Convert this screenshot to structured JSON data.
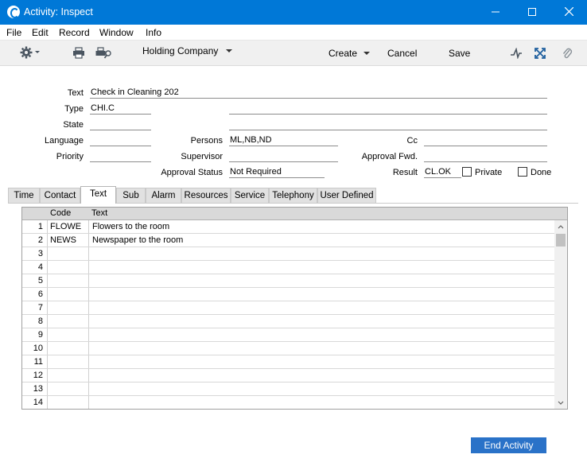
{
  "window": {
    "title": "Activity: Inspect",
    "minimize": "—",
    "maximize": "☐",
    "close": "✕"
  },
  "menu": [
    "File",
    "Edit",
    "Record",
    "Window",
    "Info"
  ],
  "toolbar": {
    "company": "Holding Company",
    "create": "Create",
    "cancel": "Cancel",
    "save": "Save"
  },
  "form": {
    "text_label": "Text",
    "text_value": "Check in Cleaning 202",
    "type_label": "Type",
    "type_value": "CHI.C",
    "state_label": "State",
    "state_value": "",
    "language_label": "Language",
    "language_value": "",
    "priority_label": "Priority",
    "priority_value": "",
    "persons_label": "Persons",
    "persons_value": "ML,NB,ND",
    "supervisor_label": "Supervisor",
    "supervisor_value": "",
    "approval_status_label": "Approval Status",
    "approval_status_value": "Not Required",
    "cc_label": "Cc",
    "cc_value": "",
    "approval_fwd_label": "Approval Fwd.",
    "approval_fwd_value": "",
    "result_label": "Result",
    "result_value": "CL.OK",
    "private_label": "Private",
    "private_checked": false,
    "done_label": "Done",
    "done_checked": false
  },
  "tabs": [
    "Time",
    "Contact",
    "Text",
    "Sub",
    "Alarm",
    "Resources",
    "Service",
    "Telephony",
    "User Defined"
  ],
  "active_tab": "Text",
  "grid": {
    "headers": {
      "code": "Code",
      "text": "Text"
    },
    "rows": [
      {
        "num": "1",
        "code": "FLOWE",
        "text": "Flowers to the room"
      },
      {
        "num": "2",
        "code": "NEWS",
        "text": "Newspaper to the room"
      },
      {
        "num": "3",
        "code": "",
        "text": ""
      },
      {
        "num": "4",
        "code": "",
        "text": ""
      },
      {
        "num": "5",
        "code": "",
        "text": ""
      },
      {
        "num": "6",
        "code": "",
        "text": ""
      },
      {
        "num": "7",
        "code": "",
        "text": ""
      },
      {
        "num": "8",
        "code": "",
        "text": ""
      },
      {
        "num": "9",
        "code": "",
        "text": ""
      },
      {
        "num": "10",
        "code": "",
        "text": ""
      },
      {
        "num": "11",
        "code": "",
        "text": ""
      },
      {
        "num": "12",
        "code": "",
        "text": ""
      },
      {
        "num": "13",
        "code": "",
        "text": ""
      },
      {
        "num": "14",
        "code": "",
        "text": ""
      }
    ]
  },
  "end_activity": "End Activity",
  "colors": {
    "titlebar": "#0078d7",
    "button": "#2a72c8"
  }
}
